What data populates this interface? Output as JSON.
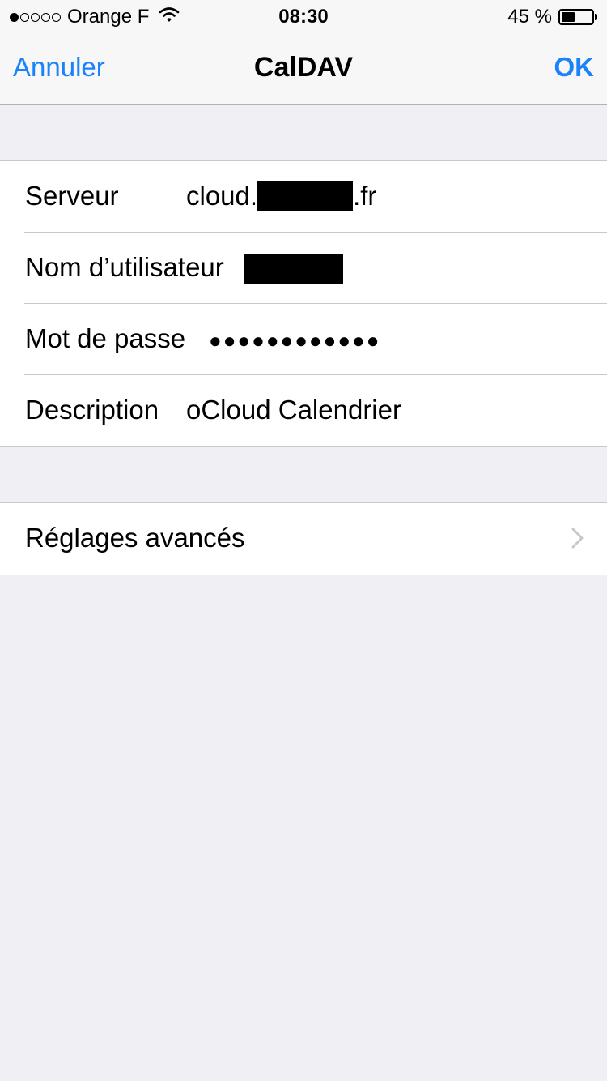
{
  "status_bar": {
    "signal_dots": [
      true,
      false,
      false,
      false,
      false
    ],
    "carrier": "Orange F",
    "wifi_icon": "wifi-icon",
    "time": "08:30",
    "battery_percent": "45 %",
    "battery_level": 0.45
  },
  "nav": {
    "cancel_label": "Annuler",
    "title": "CalDAV",
    "ok_label": "OK",
    "accent_color": "#1a82fb"
  },
  "account_fields": {
    "server": {
      "label": "Serveur",
      "value_prefix": "cloud.",
      "value_suffix": ".fr"
    },
    "username": {
      "label": "Nom d’utilisateur"
    },
    "password": {
      "label": "Mot de passe",
      "value": "●●●●●●●●●●●●"
    },
    "description": {
      "label": "Description",
      "value": "oCloud Calendrier"
    }
  },
  "advanced": {
    "label": "Réglages avancés",
    "icon": "chevron-right-icon"
  }
}
